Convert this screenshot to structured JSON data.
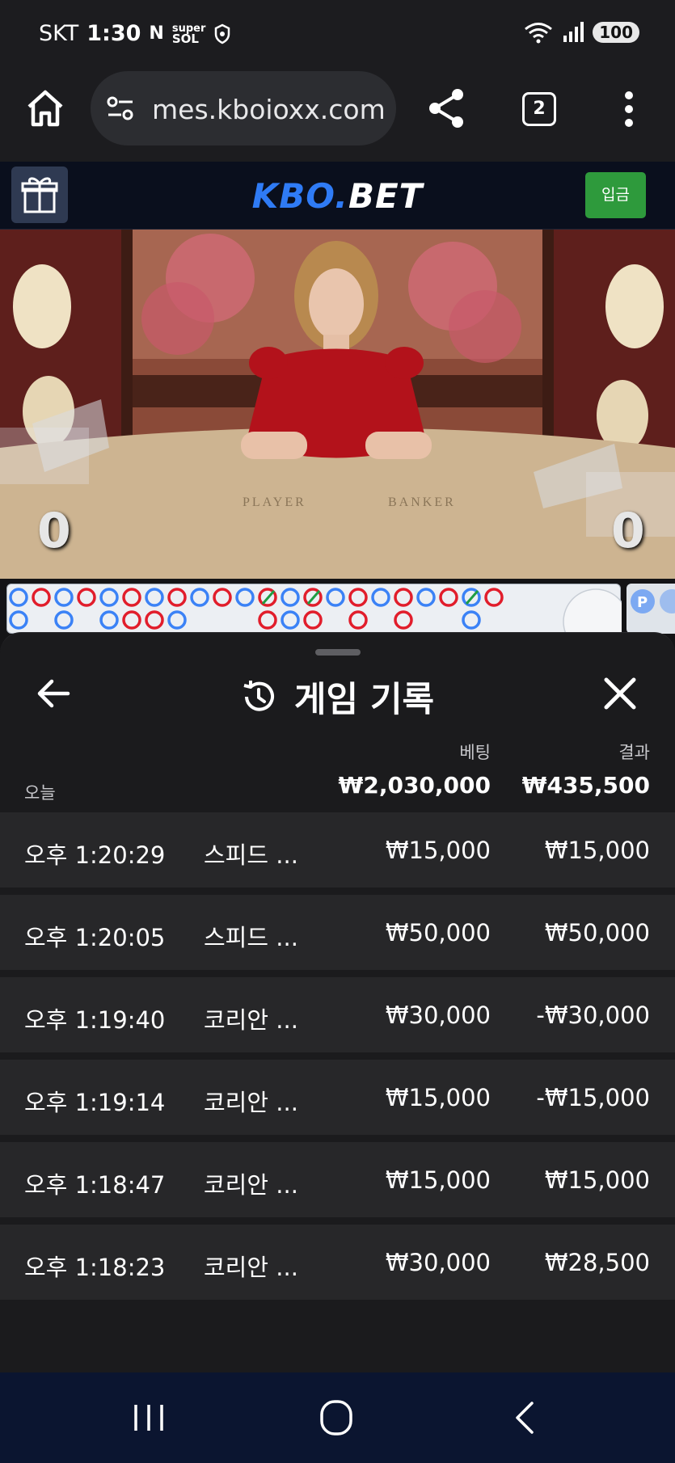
{
  "status_bar": {
    "carrier": "SKT",
    "time": "1:30",
    "glyph_n": "N",
    "glyph_super": "super",
    "glyph_sol": "SOL",
    "battery": "100",
    "icons": [
      "wifi-icon",
      "signal-icon"
    ]
  },
  "browser": {
    "url": "mes.kboioxx.com",
    "tab_count": "2",
    "icons": [
      "home-icon",
      "site-settings-icon",
      "share-icon",
      "more-vert-icon"
    ]
  },
  "site_header": {
    "logo_part1": "KBO.",
    "logo_part2": "BET",
    "deposit_label": "입금",
    "icons": [
      "gift-icon"
    ]
  },
  "video": {
    "player_score": "0",
    "banker_score": "0"
  },
  "history": {
    "title": "게임 기록",
    "icons": [
      "back-arrow-icon",
      "history-icon",
      "close-icon"
    ],
    "col_bet": "베팅",
    "col_result": "결과",
    "today_label": "오늘",
    "total_bet": "₩2,030,000",
    "total_result": "₩435,500",
    "rows": [
      {
        "time": "오후 1:20:29",
        "game": "스피드 ...",
        "bet": "₩15,000",
        "result": "₩15,000"
      },
      {
        "time": "오후 1:20:05",
        "game": "스피드 ...",
        "bet": "₩50,000",
        "result": "₩50,000"
      },
      {
        "time": "오후 1:19:40",
        "game": "코리안 ...",
        "bet": "₩30,000",
        "result": "-₩30,000"
      },
      {
        "time": "오후 1:19:14",
        "game": "코리안 ...",
        "bet": "₩15,000",
        "result": "-₩15,000"
      },
      {
        "time": "오후 1:18:47",
        "game": "코리안 ...",
        "bet": "₩15,000",
        "result": "₩15,000"
      },
      {
        "time": "오후 1:18:23",
        "game": "코리안 ...",
        "bet": "₩30,000",
        "result": "₩28,500"
      }
    ]
  },
  "nav": {
    "icons": [
      "recents-icon",
      "home-circle-icon",
      "back-chevron-icon"
    ]
  },
  "colors": {
    "player_blue": "#3b82f6",
    "banker_red": "#e11d2b",
    "deposit_green": "#2e9a3c",
    "logo_blue": "#2f7bf5"
  }
}
